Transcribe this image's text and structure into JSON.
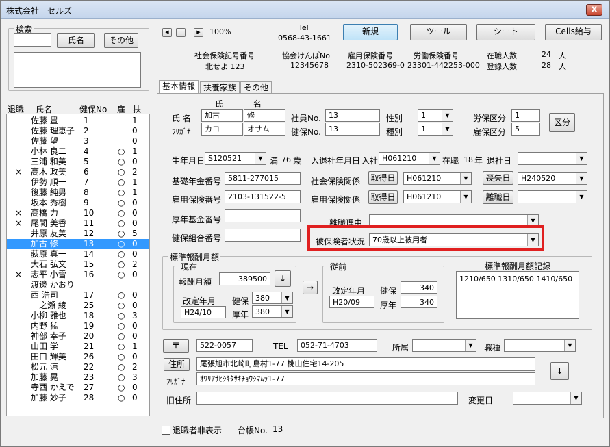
{
  "window": {
    "title": "株式会社　セルズ",
    "close": "x"
  },
  "search": {
    "caption": "検索",
    "name_button": "氏名",
    "other_button": "その他"
  },
  "list": {
    "headers": [
      "退職",
      "氏名",
      "健保No",
      "雇",
      "扶"
    ],
    "rows": [
      {
        "ret": "",
        "name": "佐藤 豊",
        "no": "1",
        "koyo": "",
        "fu": "1"
      },
      {
        "ret": "",
        "name": "佐藤 理恵子",
        "no": "2",
        "koyo": "",
        "fu": "0"
      },
      {
        "ret": "",
        "name": "佐藤 望",
        "no": "3",
        "koyo": "",
        "fu": "0"
      },
      {
        "ret": "",
        "name": "小林 良二",
        "no": "4",
        "koyo": "○",
        "fu": "1"
      },
      {
        "ret": "",
        "name": "三浦 和美",
        "no": "5",
        "koyo": "○",
        "fu": "0"
      },
      {
        "ret": "×",
        "name": "高木 政美",
        "no": "6",
        "koyo": "○",
        "fu": "2"
      },
      {
        "ret": "",
        "name": "伊勢 順一",
        "no": "7",
        "koyo": "○",
        "fu": "1"
      },
      {
        "ret": "",
        "name": "後藤 純男",
        "no": "8",
        "koyo": "○",
        "fu": "1"
      },
      {
        "ret": "",
        "name": "坂本 秀樹",
        "no": "9",
        "koyo": "○",
        "fu": "0"
      },
      {
        "ret": "×",
        "name": "高橋 力",
        "no": "10",
        "koyo": "○",
        "fu": "0"
      },
      {
        "ret": "×",
        "name": "尾関 美香",
        "no": "11",
        "koyo": "○",
        "fu": "0"
      },
      {
        "ret": "",
        "name": "井原 友美",
        "no": "12",
        "koyo": "○",
        "fu": "5"
      },
      {
        "ret": "",
        "name": "加古 修",
        "no": "13",
        "koyo": "○",
        "fu": "0"
      },
      {
        "ret": "",
        "name": "荻原 真一",
        "no": "14",
        "koyo": "○",
        "fu": "0"
      },
      {
        "ret": "",
        "name": "大石 弘文",
        "no": "15",
        "koyo": "○",
        "fu": "2"
      },
      {
        "ret": "×",
        "name": "志平 小雪",
        "no": "16",
        "koyo": "○",
        "fu": "0"
      },
      {
        "ret": "",
        "name": "渡邊 かおり",
        "no": "",
        "koyo": "",
        "fu": ""
      },
      {
        "ret": "",
        "name": "西 浩司",
        "no": "17",
        "koyo": "○",
        "fu": "0"
      },
      {
        "ret": "",
        "name": "一之瀬 綾",
        "no": "25",
        "koyo": "○",
        "fu": "0"
      },
      {
        "ret": "",
        "name": "小柳 雅也",
        "no": "18",
        "koyo": "○",
        "fu": "3"
      },
      {
        "ret": "",
        "name": "内野 猛",
        "no": "19",
        "koyo": "○",
        "fu": "0"
      },
      {
        "ret": "",
        "name": "神部 幸子",
        "no": "20",
        "koyo": "○",
        "fu": "0"
      },
      {
        "ret": "",
        "name": "山田 学",
        "no": "21",
        "koyo": "○",
        "fu": "1"
      },
      {
        "ret": "",
        "name": "田口 輝美",
        "no": "26",
        "koyo": "○",
        "fu": "0"
      },
      {
        "ret": "",
        "name": "松元 涼",
        "no": "22",
        "koyo": "○",
        "fu": "2"
      },
      {
        "ret": "",
        "name": "加藤 晃",
        "no": "23",
        "koyo": "○",
        "fu": "3"
      },
      {
        "ret": "",
        "name": "寺西 かえで",
        "no": "27",
        "koyo": "○",
        "fu": "0"
      },
      {
        "ret": "",
        "name": "加藤 妙子",
        "no": "28",
        "koyo": "○",
        "fu": "0"
      }
    ],
    "selected_index": 12
  },
  "nav": {
    "first": "◀",
    "prev": "",
    "next": "▶",
    "zoom": "100%"
  },
  "company": {
    "tel_label": "Tel",
    "tel": "0568-43-1661",
    "h1": "社会保険記号番号",
    "v1": "北せよ 123",
    "h2": "協会けんぽNo",
    "v2": "12345678",
    "h3": "雇用保険番号",
    "v3": "2310-502369-0",
    "h4": "労働保険番号",
    "v4": "23301-442253-000",
    "h5": "在職人数",
    "v5": "24",
    "u5": "人",
    "h6": "登録人数",
    "v6": "28",
    "u6": "人"
  },
  "topbuttons": {
    "new": "新規",
    "tool": "ツール",
    "sheet": "シート",
    "cells": "Cells給与"
  },
  "tabs": [
    "基本情報",
    "扶養家族",
    "その他"
  ],
  "form": {
    "col_shi": "氏",
    "col_mei": "名",
    "name_label": "氏 名",
    "kana_label": "ﾌﾘｶﾞﾅ",
    "last": "加古",
    "first": "修",
    "last_kana": "カコ",
    "first_kana": "オサム",
    "emp_no_label": "社員No.",
    "emp_no": "13",
    "kenpo_no_label": "健保No.",
    "kenpo_no": "13",
    "sex_label": "性別",
    "sex": "1",
    "kind_label": "種別",
    "kind": "1",
    "rouho_label": "労保区分",
    "rouho": "1",
    "koyo_label": "雇保区分",
    "koyo": "5",
    "kubun_button": "区分",
    "birth_label": "生年月日",
    "birth": "S120521",
    "age_prefix": "満",
    "age": "76",
    "age_unit": "歳",
    "join_label": "入退社年月日",
    "join_prefix": "入社",
    "join": "H061210",
    "tenure_prefix": "在職",
    "tenure": "18",
    "tenure_unit": "年",
    "leave_label": "退社日",
    "leave": "",
    "kiso_label": "基礎年金番号",
    "kiso": "5811-277015",
    "shaho_label": "社会保険関係",
    "shutoku_button": "取得日",
    "shaho_date": "H061210",
    "soshitsu_button": "喪失日",
    "soshitsu_date": "H240520",
    "koyo_no_label": "雇用保険番号",
    "koyo_no": "2103-131522-5",
    "koyo_rel_label": "雇用保険関係",
    "koyo_shutoku_button": "取得日",
    "koyo_date": "H061210",
    "rishoku_button": "離職日",
    "rishoku_date": "",
    "kosei_label": "厚年基金番号",
    "kosei": "",
    "riyu_label": "離職理由",
    "riyu": "",
    "kumiai_label": "健保組合番号",
    "kumiai": "",
    "hihoken_label": "被保険者状況",
    "hihoken": "70歳以上被用者"
  },
  "monthly": {
    "caption": "標準報酬月額",
    "current_caption": "現在",
    "amount_label": "報酬月額",
    "amount": "389500",
    "down_button": "↓",
    "kaitei_label": "改定年月",
    "kaitei": "H24/10",
    "kenpo_label": "健保",
    "kenpo": "380",
    "kounen_label": "厚年",
    "kounen": "380",
    "arrow_button": "→",
    "prev_caption": "従前",
    "prev_kaitei_label": "改定年月",
    "prev_kaitei": "H20/09",
    "prev_kenpo_label": "健保",
    "prev_kenpo": "340",
    "prev_kounen_label": "厚年",
    "prev_kounen": "340",
    "record_label": "標準報酬月額記録",
    "record": "1210/650 1310/650 1410/650"
  },
  "address": {
    "zip_button": "〒",
    "zip": "522-0057",
    "tel_label": "TEL",
    "tel": "052-71-4703",
    "shozoku_label": "所属",
    "shozoku": "",
    "shokushu_label": "職種",
    "shokushu": "",
    "addr_button": "住所",
    "addr": "尾張旭市北崎町島村1-77 桃山住宅14-205",
    "kana_label": "ﾌﾘｶﾞﾅ",
    "kana": "ｵﾜﾘｱｻﾋｼｷﾀｻｷﾁｮｳｼﾏﾑﾗ1-77",
    "down_button": "↓",
    "old_label": "旧住所",
    "old": "",
    "change_label": "変更日",
    "change": ""
  },
  "footer": {
    "hide_retired": "退職者非表示",
    "daicho_label": "台帳No.",
    "daicho": "13"
  }
}
